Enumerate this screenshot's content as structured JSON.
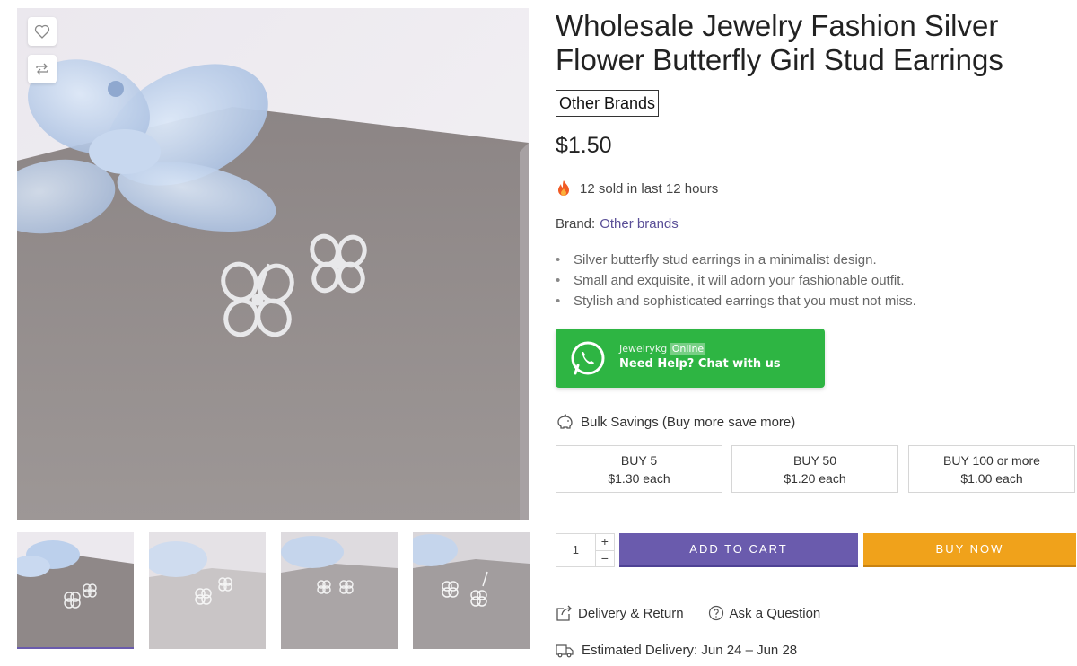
{
  "product": {
    "title": "Wholesale Jewelry Fashion Silver Flower Butterfly Girl Stud Earrings",
    "brand_badge": "Other Brands",
    "price": "$1.50",
    "sold_text": "12 sold in last 12 hours",
    "brand_label": "Brand:",
    "brand_value": "Other brands",
    "features": [
      "Silver butterfly stud earrings in a minimalist design.",
      "Small and exquisite, it will adorn your fashionable outfit.",
      "Stylish and sophisticated earrings that you must not miss."
    ]
  },
  "whatsapp": {
    "name": "Jewelrykg",
    "status": "Online",
    "cta": "Need Help? Chat with us",
    "color": "#2eb543"
  },
  "bulk": {
    "heading": "Bulk Savings (Buy more save more)",
    "tiers": [
      {
        "qty": "BUY 5",
        "price": "$1.30 each"
      },
      {
        "qty": "BUY 50",
        "price": "$1.20 each"
      },
      {
        "qty": "BUY 100 or more",
        "price": "$1.00 each"
      }
    ]
  },
  "purchase": {
    "quantity": "1",
    "plus": "+",
    "minus": "−",
    "add_to_cart": "ADD TO CART",
    "buy_now": "BUY NOW",
    "cart_color": "#6a5bad",
    "buy_color": "#f0a21b"
  },
  "links": {
    "delivery_return": "Delivery & Return",
    "ask_question": "Ask a Question"
  },
  "delivery": {
    "estimate": "Estimated Delivery: Jun 24 – Jun 28"
  },
  "gallery": {
    "thumbnail_count": 4,
    "icons": [
      "heart-icon",
      "compare-icon"
    ]
  }
}
